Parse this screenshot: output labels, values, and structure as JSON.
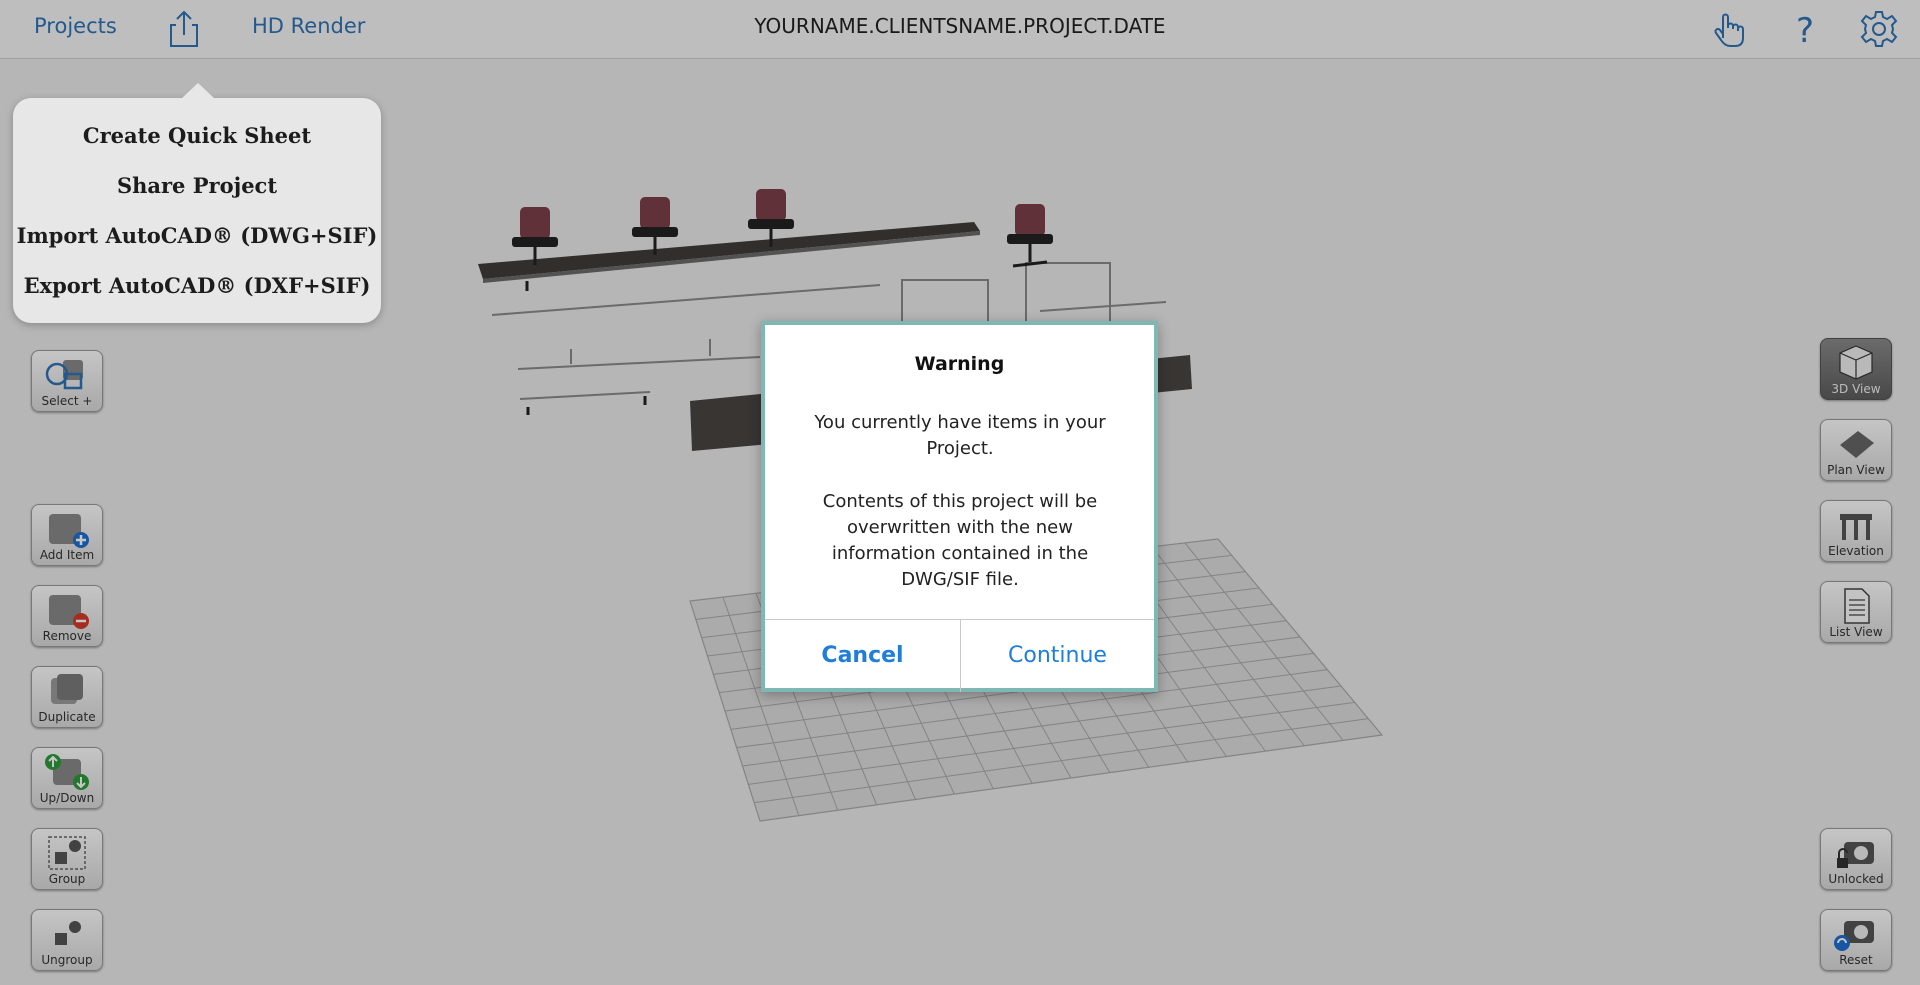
{
  "topbar": {
    "projects_label": "Projects",
    "hd_render_label": "HD Render",
    "project_title": "YOURNAME.CLIENTSNAME.PROJECT.DATE",
    "icons": [
      "share-icon",
      "hand-pointer-icon",
      "help-icon",
      "settings-gear-icon"
    ]
  },
  "share_menu": {
    "items": [
      {
        "label": "Create Quick Sheet"
      },
      {
        "label": "Share Project"
      },
      {
        "label": "Import AutoCAD® (DWG+SIF)"
      },
      {
        "label": "Export AutoCAD® (DXF+SIF)"
      }
    ]
  },
  "left_tools": [
    {
      "label": "Select +",
      "icon": "select-shapes-icon"
    },
    {
      "label": "Add Item",
      "icon": "add-item-icon"
    },
    {
      "label": "Remove",
      "icon": "remove-item-icon"
    },
    {
      "label": "Duplicate",
      "icon": "duplicate-icon"
    },
    {
      "label": "Up/Down",
      "icon": "up-down-arrows-icon"
    },
    {
      "label": "Group",
      "icon": "group-icon"
    },
    {
      "label": "Ungroup",
      "icon": "ungroup-icon"
    }
  ],
  "right_tools": [
    {
      "label": "3D View",
      "icon": "cube-3d-icon",
      "active": true
    },
    {
      "label": "Plan View",
      "icon": "plan-view-icon"
    },
    {
      "label": "Elevation",
      "icon": "elevation-icon"
    },
    {
      "label": "List View",
      "icon": "list-document-icon"
    },
    {
      "label": "Unlocked",
      "icon": "camera-unlocked-icon"
    },
    {
      "label": "Reset",
      "icon": "camera-reset-icon"
    }
  ],
  "dialog": {
    "title": "Warning",
    "message_1": "You currently have items in your Project.",
    "message_2": "Contents of this project will be overwritten with the new information contained in the DWG/SIF file.",
    "cancel_label": "Cancel",
    "continue_label": "Continue"
  },
  "colors": {
    "link_blue": "#2f73b5",
    "dialog_button_blue": "#1f7fd8",
    "dialog_border": "#7fb8b2"
  }
}
